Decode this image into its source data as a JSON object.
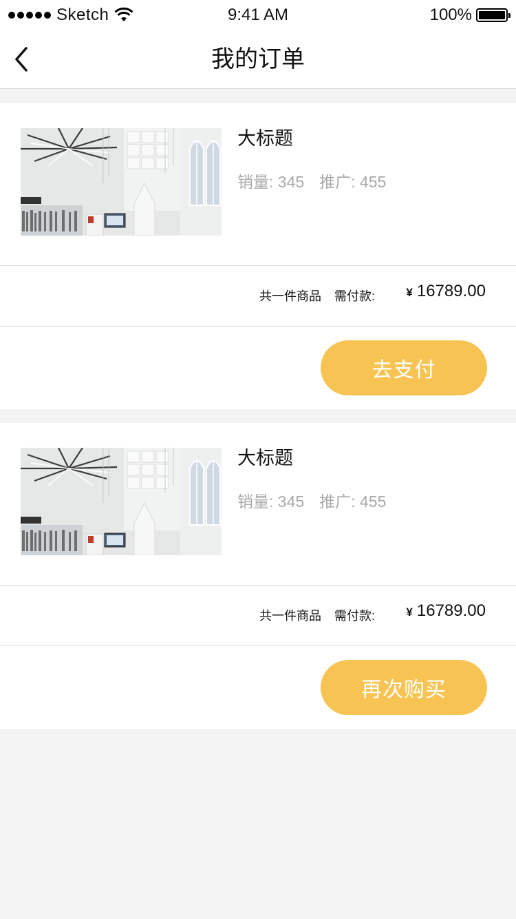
{
  "status_bar": {
    "carrier": "Sketch",
    "time": "9:41 AM",
    "battery": "100%"
  },
  "nav": {
    "title": "我的订单",
    "back_icon": "chevron-left-icon"
  },
  "orders": [
    {
      "image": "interior-hall-photo",
      "title": "大标题",
      "sales_label": "销量: 345",
      "promo_label": "推广: 455",
      "item_count": "共一件商品",
      "pay_label": "需付款:",
      "currency": "¥",
      "amount": "16789.00",
      "action": "去支付"
    },
    {
      "image": "interior-hall-photo",
      "title": "大标题",
      "sales_label": "销量: 345",
      "promo_label": "推广: 455",
      "item_count": "共一件商品",
      "pay_label": "需付款:",
      "currency": "¥",
      "amount": "16789.00",
      "action": "再次购买"
    }
  ],
  "colors": {
    "accent": "#f7c453",
    "background": "#f3f3f3",
    "muted_text": "#a9a9a9"
  }
}
